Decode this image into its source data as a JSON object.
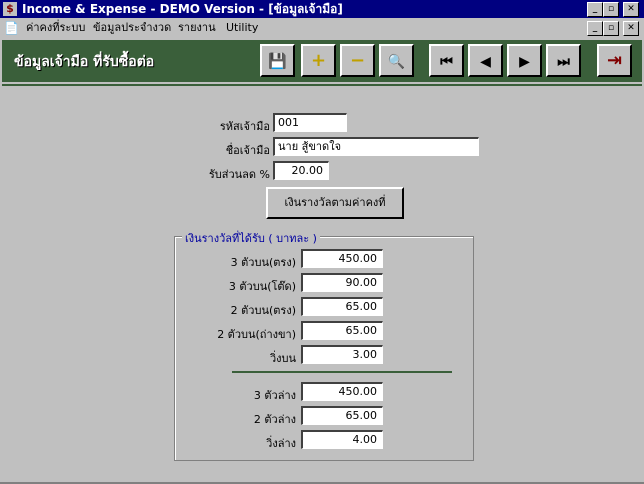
{
  "window": {
    "title": "Income & Expense - DEMO Version - [ข้อมูลเจ้ามือ]",
    "app_icon": "$",
    "controls": {
      "minimize": "_",
      "maximize": "▫",
      "close": "✕"
    }
  },
  "menu": {
    "items": [
      {
        "label": "ค่าคงที่ระบบ"
      },
      {
        "label": "ข้อมูลประจำงวด"
      },
      {
        "label": "รายงาน"
      },
      {
        "label": "Utility"
      }
    ]
  },
  "header": {
    "title": "ข้อมูลเจ้ามือ ที่รับซื้อต่อ"
  },
  "toolbar": {
    "save_icon": "💾",
    "add_icon": "+",
    "remove_icon": "−",
    "find_icon": "🔍",
    "first_icon": "⏮",
    "prev_icon": "◀",
    "next_icon": "▶",
    "last_icon": "⏭",
    "exit_icon": "⇥"
  },
  "form": {
    "code_label": "รหัสเจ้ามือ",
    "code_value": "001",
    "name_label": "ชื่อเจ้ามือ",
    "name_value": "นาย สู้ขาดใจ",
    "discount_label": "รับส่วนลด %",
    "discount_value": "20.00",
    "prize_button": "เงินรางวัลตามค่าคงที่"
  },
  "prizes": {
    "group_title": "เงินรางวัลที่ได้รับ ( บาทละ )",
    "upper": [
      {
        "label": "3 ตัวบน(ตรง)",
        "value": "450.00"
      },
      {
        "label": "3 ตัวบน(โต๊ด)",
        "value": "90.00"
      },
      {
        "label": "2 ตัวบน(ตรง)",
        "value": "65.00"
      },
      {
        "label": "2 ตัวบน(ถ่างขา)",
        "value": "65.00"
      },
      {
        "label": "วิ่งบน",
        "value": "3.00"
      }
    ],
    "lower": [
      {
        "label": "3 ตัวล่าง",
        "value": "450.00"
      },
      {
        "label": "2 ตัวล่าง",
        "value": "65.00"
      },
      {
        "label": "วิ่งล่าง",
        "value": "4.00"
      }
    ]
  },
  "colors": {
    "title_bar": "#000080",
    "header_band": "#3a5f3a",
    "background": "#c0c0c0",
    "group_title": "#0000a0"
  }
}
